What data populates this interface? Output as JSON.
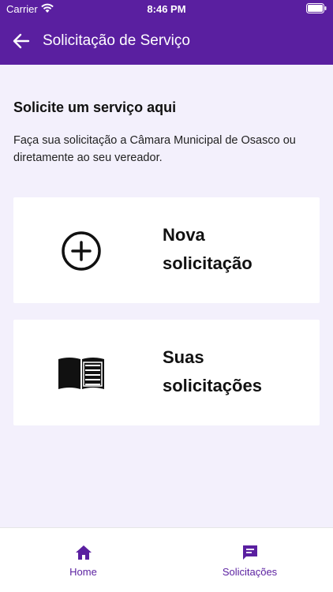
{
  "status_bar": {
    "carrier": "Carrier",
    "time": "8:46 PM",
    "wifi_icon": "wifi-icon",
    "battery_icon": "battery-icon"
  },
  "header": {
    "title": "Solicitação de Serviço",
    "back_icon": "arrow-left-icon",
    "color": "#5a1fa0"
  },
  "intro": {
    "title": "Solicite um serviço aqui",
    "description": "Faça sua solicitação a Câmara Municipal de Osasco ou diretamente ao seu vereador."
  },
  "cards": [
    {
      "label_line1": "Nova",
      "label_line2": "solicitação",
      "icon": "plus-circle-icon"
    },
    {
      "label_line1": "Suas",
      "label_line2": "solicitações",
      "icon": "book-icon"
    }
  ],
  "tabbar": {
    "tabs": [
      {
        "label": "Home",
        "icon": "home-icon"
      },
      {
        "label": "Solicitações",
        "icon": "chat-icon"
      }
    ],
    "accent": "#5a1fa0"
  }
}
